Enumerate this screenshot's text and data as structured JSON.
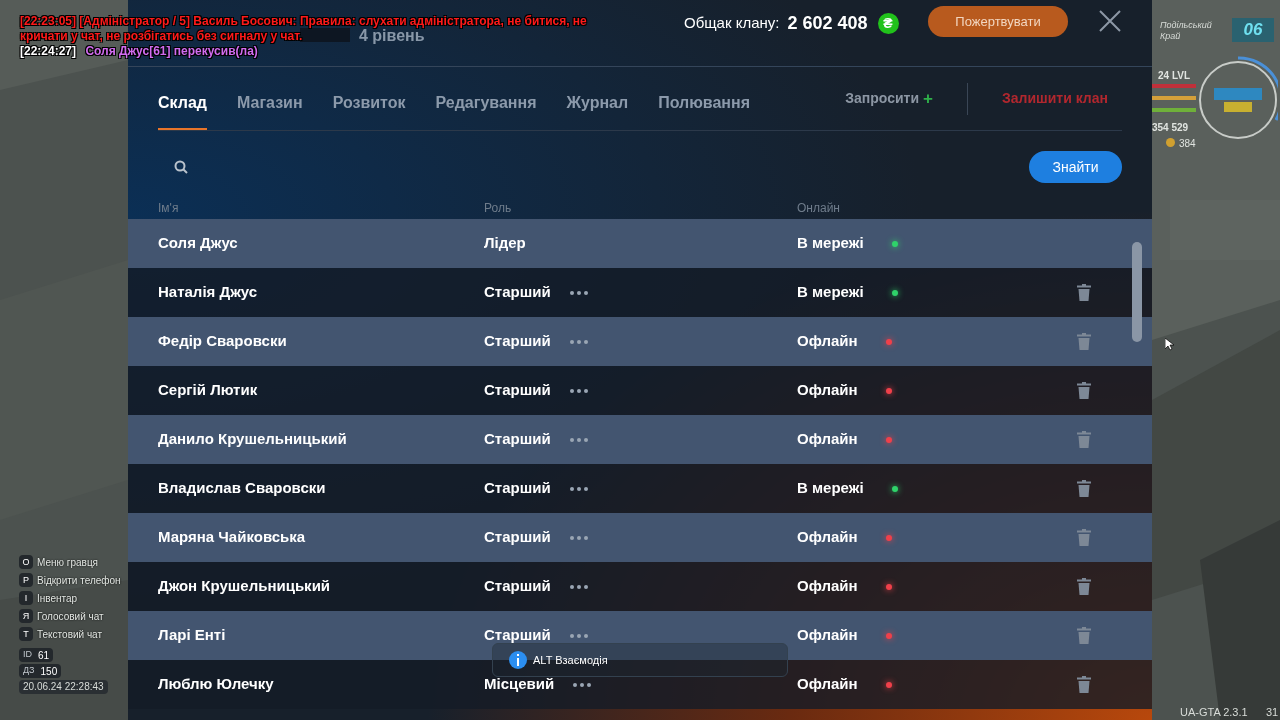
{
  "chat": [
    {
      "kind": "admin",
      "time": "[22:23:05]",
      "lines": [
        "[Адміністратор / 5] Василь Босович: Правила: слухати адміністратора, не битися, не",
        "кричати у чат, не розбігатись без сигналу у чат."
      ]
    },
    {
      "kind": "action",
      "time": "[22:24:27]",
      "lines": [
        "Соля Джус[61] перекусив(ла)"
      ]
    }
  ],
  "clan": {
    "level": "4 рівень"
  },
  "treasury": {
    "label": "Общак клану:",
    "amount": "2 602 408",
    "currency": "₴"
  },
  "donate_button": "Пожертвувати",
  "tabs": [
    {
      "label": "Склад",
      "selected": true
    },
    {
      "label": "Магазин",
      "selected": false
    },
    {
      "label": "Розвиток",
      "selected": false
    },
    {
      "label": "Редагування",
      "selected": false
    },
    {
      "label": "Журнал",
      "selected": false
    },
    {
      "label": "Полювання",
      "selected": false
    }
  ],
  "invite_button": {
    "label": "Запросити",
    "icon": "+"
  },
  "leave_button": "Залишити клан",
  "search_button": "Знайти",
  "columns": [
    "Ім'я",
    "Роль",
    "Онлайн"
  ],
  "members": [
    {
      "kind": "leader",
      "name": "Соля Джус",
      "role": "Лідер",
      "status": "В мережі",
      "color": "#2fd36a"
    },
    {
      "kind": "member",
      "name": "Наталія Джус",
      "role": "Старший",
      "status": "В мережі",
      "color": "#2fd36a"
    },
    {
      "kind": "member",
      "name": "Федір Сваровски",
      "role": "Старший",
      "status": "Офлайн",
      "color": "#f0404a"
    },
    {
      "kind": "member",
      "name": "Сергій Лютик",
      "role": "Старший",
      "status": "Офлайн",
      "color": "#f0404a"
    },
    {
      "kind": "member",
      "name": "Данило Крушельницький",
      "role": "Старший",
      "status": "Офлайн",
      "color": "#f0404a"
    },
    {
      "kind": "member",
      "name": "Владислав Сваровски",
      "role": "Старший",
      "status": "В мережі",
      "color": "#2fd36a"
    },
    {
      "kind": "member",
      "name": "Маряна Чайковська",
      "role": "Старший",
      "status": "Офлайн",
      "color": "#f0404a"
    },
    {
      "kind": "member",
      "name": "Джон Крушельницький",
      "role": "Старший",
      "status": "Офлайн",
      "color": "#f0404a"
    },
    {
      "kind": "member",
      "name": "Ларі Енті",
      "role": "Старший",
      "status": "Офлайн",
      "color": "#f0404a"
    },
    {
      "kind": "member",
      "name": "Люблю Юлечку",
      "role": "Місцевий",
      "status": "Офлайн",
      "color": "#f0404a"
    }
  ],
  "hint": "ALT Взаємодія",
  "key_hints": [
    {
      "key": "O",
      "label": "Меню гравця"
    },
    {
      "key": "P",
      "label": "Відкрити телефон"
    },
    {
      "key": "I",
      "label": "Інвентар"
    },
    {
      "key": "Я",
      "label": "Голосовий чат"
    },
    {
      "key": "T",
      "label": "Текстовий чат"
    }
  ],
  "player_stats": [
    {
      "label": "ID",
      "value": "61"
    },
    {
      "label": "ДЗ",
      "value": "150"
    }
  ],
  "datetime": "20.06.24 22:28:43",
  "region": {
    "name": "Подільський Край",
    "number": "06"
  },
  "player_level": "24 LVL",
  "money": "354 529",
  "coins": "384",
  "version": "UA-GTA 2.3.1",
  "fps": "31"
}
